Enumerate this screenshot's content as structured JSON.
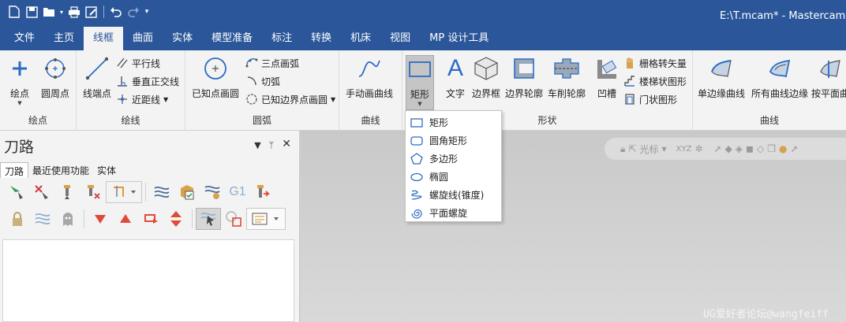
{
  "app": {
    "title": "E:\\T.mcam* - Mastercam 设"
  },
  "tabs": [
    "文件",
    "主页",
    "线框",
    "曲面",
    "实体",
    "模型准备",
    "标注",
    "转换",
    "机床",
    "视图",
    "MP 设计工具"
  ],
  "ribbon": {
    "point_group": {
      "label": "绘点",
      "point_btn": "绘点",
      "circle_point_btn": "圆周点"
    },
    "line_group": {
      "label": "绘线",
      "endpoints_btn": "线端点",
      "parallel": "平行线",
      "perpendicular": "垂直正交线",
      "closest": "近距线"
    },
    "arc_group": {
      "label": "圆弧",
      "known_center_btn": "已知点画圆",
      "three_point_arc": "三点画弧",
      "tangent_arc": "切弧",
      "known_edge_circle": "已知边界点画圆"
    },
    "curve_group": {
      "label": "曲线",
      "manual_curve_btn": "手动画曲线"
    },
    "shape_group": {
      "label": "形状",
      "rectangle_btn": "矩形",
      "text_btn": "文字",
      "bounding_box_btn": "边界框",
      "boundary_contour_btn": "边界轮廓",
      "turn_profile_btn": "车削轮廓",
      "groove_btn": "凹槽",
      "grid_to_vector": "栅格转矢量",
      "stair_shape": "楼梯状图形",
      "door_shape": "门状图形"
    },
    "curves_group": {
      "label": "曲线",
      "single_edge_btn": "单边缘曲线",
      "all_edges_btn": "所有曲线边缘",
      "plane_btn": "按平面曲"
    }
  },
  "dropdown": {
    "items": [
      "矩形",
      "圆角矩形",
      "多边形",
      "椭圆",
      "螺旋线(锥度)",
      "平面螺旋"
    ]
  },
  "panel": {
    "title": "刀路",
    "tabs": [
      "刀路",
      "最近使用功能",
      "实体"
    ]
  },
  "viewport": {
    "toolbar_label": "光标",
    "axes_label": "XYZ"
  },
  "watermark": "UG爱好者论坛@wangfeiff"
}
